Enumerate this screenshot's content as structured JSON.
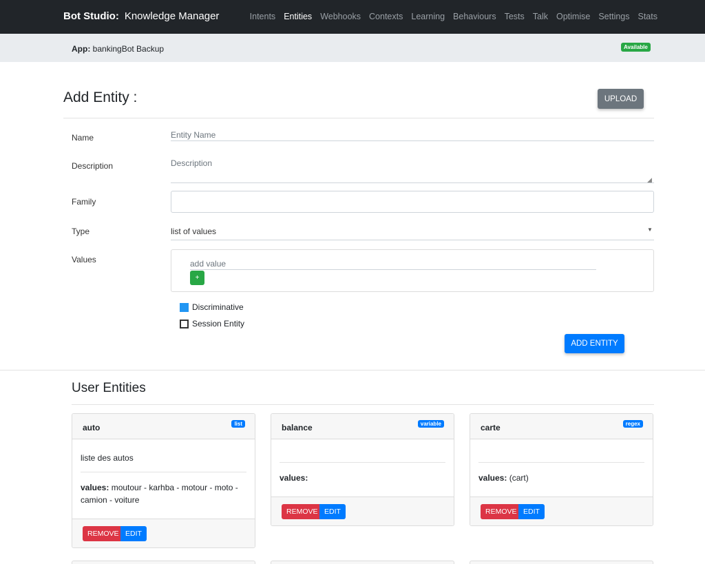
{
  "navbar": {
    "brand_bold": "Bot Studio:",
    "brand_sub": "Knowledge Manager",
    "links": [
      "Intents",
      "Entities",
      "Webhooks",
      "Contexts",
      "Learning",
      "Behaviours",
      "Tests",
      "Talk",
      "Optimise",
      "Settings",
      "Stats"
    ],
    "active": "Entities"
  },
  "appbar": {
    "label": "App:",
    "app_name": "bankingBot Backup",
    "status": "Available"
  },
  "add_entity": {
    "title": "Add Entity :",
    "upload_label": "UPLOAD",
    "name_label": "Name",
    "name_placeholder": "Entity Name",
    "description_label": "Description",
    "description_placeholder": "Description",
    "family_label": "Family",
    "family_value": "",
    "type_label": "Type",
    "type_value": "list of values",
    "values_label": "Values",
    "add_value_placeholder": "add value",
    "plus_label": "+",
    "discriminative_label": "Discriminative",
    "discriminative_checked": true,
    "session_label": "Session Entity",
    "session_checked": false,
    "submit_label": "ADD ENTITY"
  },
  "user_entities": {
    "title": "User Entities",
    "cards": [
      {
        "name": "auto",
        "type": "list",
        "description": "liste des autos",
        "values_label": "values:",
        "values": "moutour - karhba - motour - moto - camion - voiture",
        "remove": "REMOVE",
        "edit": "EDIT"
      },
      {
        "name": "balance",
        "type": "variable",
        "description": "",
        "values_label": "values:",
        "values": "",
        "remove": "REMOVE",
        "edit": "EDIT"
      },
      {
        "name": "carte",
        "type": "regex",
        "description": "",
        "values_label": "values:",
        "values": "(cart)",
        "remove": "REMOVE",
        "edit": "EDIT"
      }
    ]
  },
  "colors": {
    "navbar_bg": "#212529",
    "primary": "#007bff",
    "success": "#28a745",
    "danger": "#dc3545",
    "secondary": "#6c757d"
  }
}
